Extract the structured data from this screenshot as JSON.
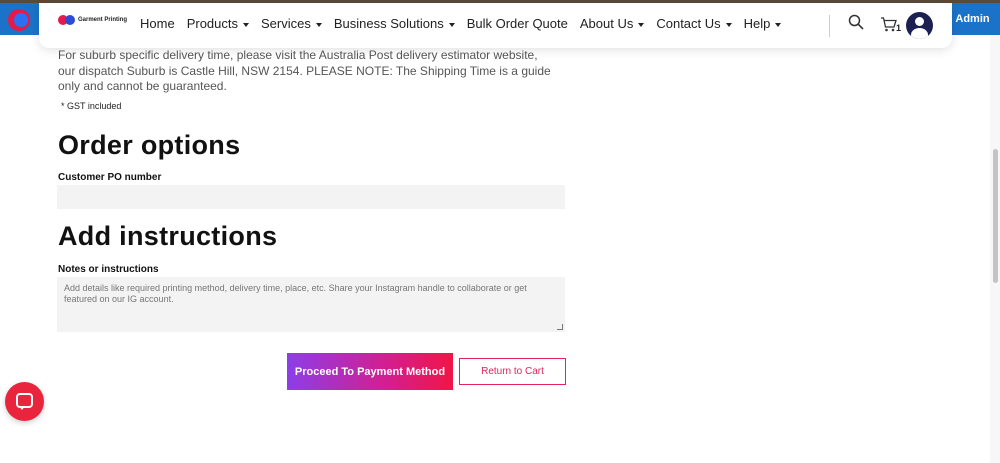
{
  "admin_bar": {
    "admin_label": "Admin"
  },
  "header": {
    "brand_text": "Garment Printing",
    "nav": [
      {
        "label": "Home",
        "dropdown": false
      },
      {
        "label": "Products",
        "dropdown": true
      },
      {
        "label": "Services",
        "dropdown": true
      },
      {
        "label": "Business Solutions",
        "dropdown": true
      },
      {
        "label": "Bulk Order Quote",
        "dropdown": false
      },
      {
        "label": "About Us",
        "dropdown": true
      },
      {
        "label": "Contact Us",
        "dropdown": true
      },
      {
        "label": "Help",
        "dropdown": true
      }
    ],
    "cart_count": "1",
    "icons": {
      "search": "search-icon",
      "cart": "cart-icon",
      "account": "user-avatar-icon"
    }
  },
  "main": {
    "delivery_note": "For suburb specific delivery time, please visit the Australia Post delivery estimator website, our dispatch Suburb is Castle Hill, NSW 2154. PLEASE NOTE: The Shipping Time is a guide only and cannot be guaranteed.",
    "gst_note": "* GST included",
    "order_options_title": "Order options",
    "po_label": "Customer PO number",
    "po_value": "",
    "instructions_title": "Add instructions",
    "notes_label": "Notes or instructions",
    "notes_placeholder": "Add details like required printing method, delivery time, place, etc. Share your Instagram handle to collaborate or get featured on our IG account.",
    "proceed_label": "Proceed To Payment Method",
    "return_label": "Return to Cart"
  },
  "colors": {
    "accent_pink": "#e0245e",
    "gradient_start": "#8c3ee8",
    "gradient_end": "#f01646",
    "admin_blue": "#1a73c8",
    "chat_red": "#e8253d"
  }
}
